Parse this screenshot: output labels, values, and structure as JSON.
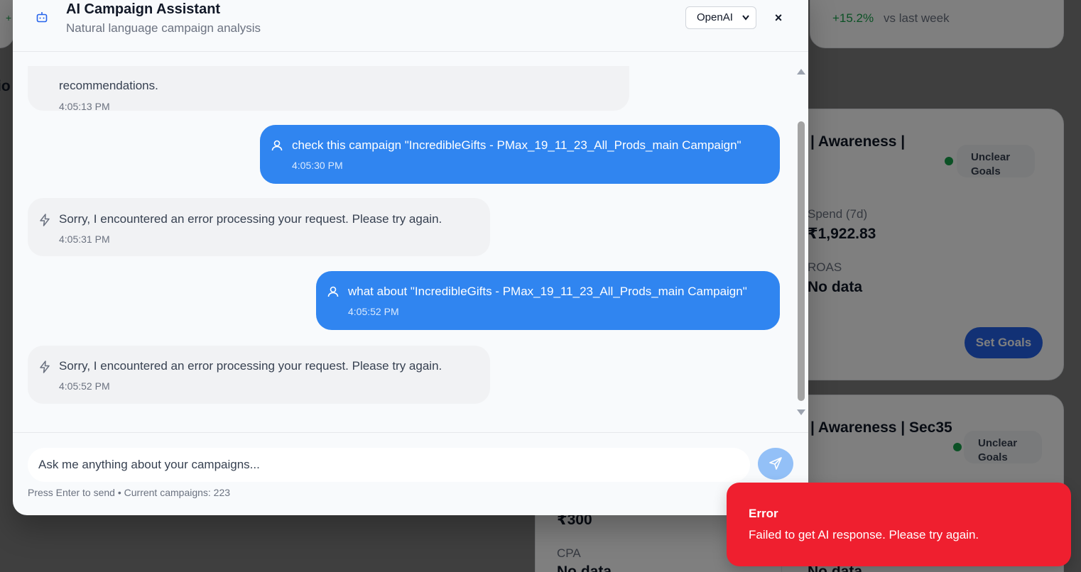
{
  "background": {
    "stat_card": {
      "change": "+15.2%",
      "vs_label": "vs last week"
    },
    "left_stat_fragment": "+",
    "section_fragment": "io",
    "campaign_1": {
      "title_fragment": "| Awareness |",
      "badge": "Unclear Goals",
      "spend_label": "Spend (7d)",
      "spend_value": "₹1,922.83",
      "roas_label": "ROAS",
      "roas_value": "No data",
      "set_goals_label": "Set Goals"
    },
    "campaign_2": {
      "title_fragment": "| Awareness | Sec35",
      "badge": "Unclear Goals",
      "value_left": "₹300",
      "cpa_label": "CPA",
      "cpa_value": "No data",
      "right_value": "No data"
    }
  },
  "modal": {
    "title": "AI Campaign Assistant",
    "subtitle": "Natural language campaign analysis",
    "provider": "OpenAI",
    "close_icon": "×",
    "messages": [
      {
        "role": "assistant",
        "text": "recommendations.",
        "time": "4:05:13 PM"
      },
      {
        "role": "user",
        "text": "check this campaign \"IncredibleGifts - PMax_19_11_23_All_Prods_main Campaign\"",
        "time": "4:05:30 PM"
      },
      {
        "role": "assistant",
        "text": "Sorry, I encountered an error processing your request. Please try again.",
        "time": "4:05:31 PM"
      },
      {
        "role": "user",
        "text": "what about \"IncredibleGifts - PMax_19_11_23_All_Prods_main Campaign\"",
        "time": "4:05:52 PM"
      },
      {
        "role": "assistant",
        "text": "Sorry, I encountered an error processing your request. Please try again.",
        "time": "4:05:52 PM"
      }
    ],
    "input_placeholder": "Ask me anything about your campaigns...",
    "hint": "Press Enter to send • Current campaigns: 223"
  },
  "toast": {
    "title": "Error",
    "message": "Failed to get AI response. Please try again.",
    "color": "#ef1f2f"
  },
  "colors": {
    "user_bubble": "#3085f0",
    "assistant_bubble": "#f1f2f4",
    "accent": "#2563eb"
  }
}
